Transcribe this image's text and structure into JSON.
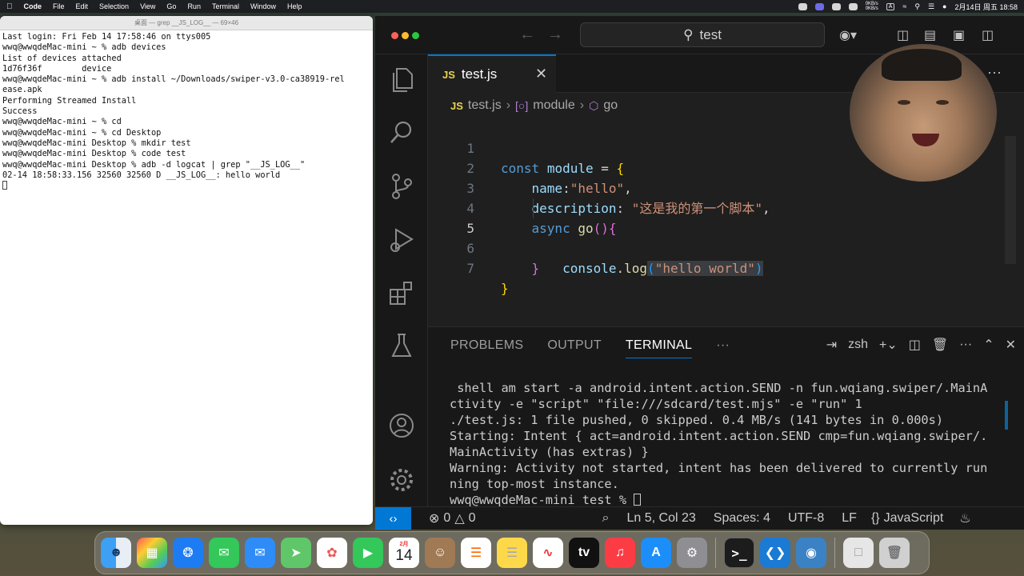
{
  "menubar": {
    "apple_icon": "apple-logo",
    "app_name": "Code",
    "items": [
      "File",
      "Edit",
      "Selection",
      "View",
      "Go",
      "Run",
      "Terminal",
      "Window",
      "Help"
    ],
    "net_up": "0KB/s",
    "net_down": "0KB/s",
    "input_method": "A",
    "datetime": "2月14日 周五 18:58"
  },
  "terminal_window": {
    "title": "桌面 — grep __JS_LOG__ — 69×46",
    "lines": [
      "Last login: Fri Feb 14 17:58:46 on ttys005",
      "wwq@wwqdeMac-mini ~ % adb devices",
      "List of devices attached",
      "1d76f36f        device",
      "",
      "wwq@wwqdeMac-mini ~ % adb install ~/Downloads/swiper-v3.0-ca38919-rel",
      "ease.apk",
      "Performing Streamed Install",
      "Success",
      "wwq@wwqdeMac-mini ~ % cd",
      "wwq@wwqdeMac-mini ~ % cd Desktop",
      "wwq@wwqdeMac-mini Desktop % mkdir test",
      "wwq@wwqdeMac-mini Desktop % code test",
      "wwq@wwqdeMac-mini Desktop % adb -d logcat | grep \"__JS_LOG__\"",
      "02-14 18:58:33.156 32560 32560 D __JS_LOG__: hello world"
    ]
  },
  "vscode": {
    "search_text": "test",
    "tab": {
      "badge": "JS",
      "label": "test.js",
      "close_icon": "close-icon"
    },
    "breadcrumb": {
      "file_badge": "JS",
      "file": "test.js",
      "symbol1": "module",
      "symbol2": "go"
    },
    "code": {
      "l1_kw": "const",
      "l1_name": "module",
      "l1_eq": " = ",
      "l1_brace": "{",
      "l2_key": "name",
      "l2_colon": ":",
      "l2_val": "\"hello\"",
      "l2_comma": ",",
      "l3_key": "description",
      "l3_colon": ": ",
      "l3_val": "\"这是我的第一个脚本\"",
      "l3_comma": ",",
      "l4_kw": "async",
      "l4_fn": "go",
      "l4_paren": "()",
      "l4_brace": "{",
      "l5_obj": "console",
      "l5_dot": ".",
      "l5_fn": "log",
      "l5_open": "(",
      "l5_str": "\"hello world\"",
      "l5_close": ")",
      "l6_brace": "}",
      "l7_brace": "}"
    },
    "line_numbers": [
      "1",
      "2",
      "3",
      "4",
      "5",
      "6",
      "7"
    ],
    "panel": {
      "tabs": [
        "PROBLEMS",
        "OUTPUT",
        "TERMINAL"
      ],
      "more": "···",
      "shell": "zsh",
      "output": [
        " shell am start -a android.intent.action.SEND -n fun.wqiang.swiper/.MainA",
        "ctivity -e \"script\" \"file:///sdcard/test.mjs\" -e \"run\" 1",
        "./test.js: 1 file pushed, 0 skipped. 0.4 MB/s (141 bytes in 0.000s)",
        "Starting: Intent { act=android.intent.action.SEND cmp=fun.wqiang.swiper/.",
        "MainActivity (has extras) }",
        "Warning: Activity not started, intent has been delivered to currently run",
        "ning top-most instance.",
        "wwq@wwqdeMac-mini test % "
      ]
    },
    "statusbar": {
      "errors": "0",
      "warnings": "0",
      "position": "Ln 5, Col 23",
      "spaces": "Spaces: 4",
      "encoding": "UTF-8",
      "eol": "LF",
      "language": "JavaScript"
    }
  },
  "dock": {
    "calendar_month": "2月",
    "calendar_day": "14",
    "tv_label": "tv"
  }
}
